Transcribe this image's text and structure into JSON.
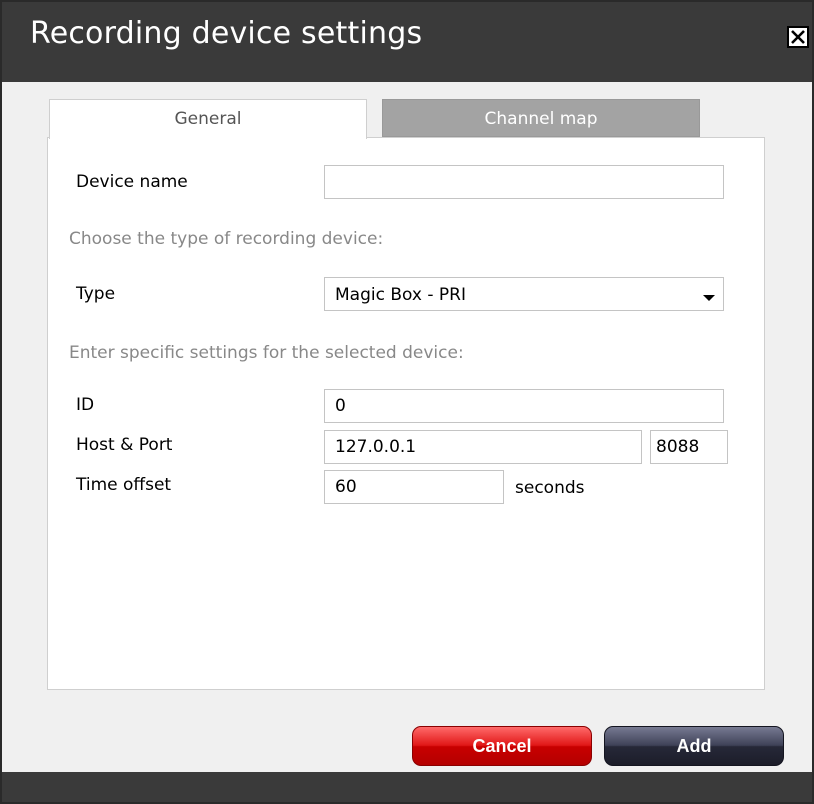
{
  "dialog": {
    "title": "Recording device settings",
    "close_icon": "close-x-icon"
  },
  "tabs": [
    {
      "label": "General",
      "active": true
    },
    {
      "label": "Channel map",
      "active": false
    }
  ],
  "form": {
    "device_name_label": "Device name",
    "device_name_value": "",
    "type_hint": "Choose the type of recording device:",
    "type_label": "Type",
    "type_value": "Magic Box - PRI",
    "settings_hint": "Enter specific settings for the selected device:",
    "id_label": "ID",
    "id_value": "0",
    "host_port_label": "Host & Port",
    "host_value": "127.0.0.1",
    "port_value": "8088",
    "time_offset_label": "Time offset",
    "time_offset_value": "60",
    "time_offset_unit": "seconds"
  },
  "buttons": {
    "cancel": "Cancel",
    "add": "Add"
  },
  "colors": {
    "title_bar": "#3a3a3a",
    "cancel_button": "#e11818",
    "add_button": "#2f3144",
    "inactive_tab": "#a3a3a3"
  }
}
